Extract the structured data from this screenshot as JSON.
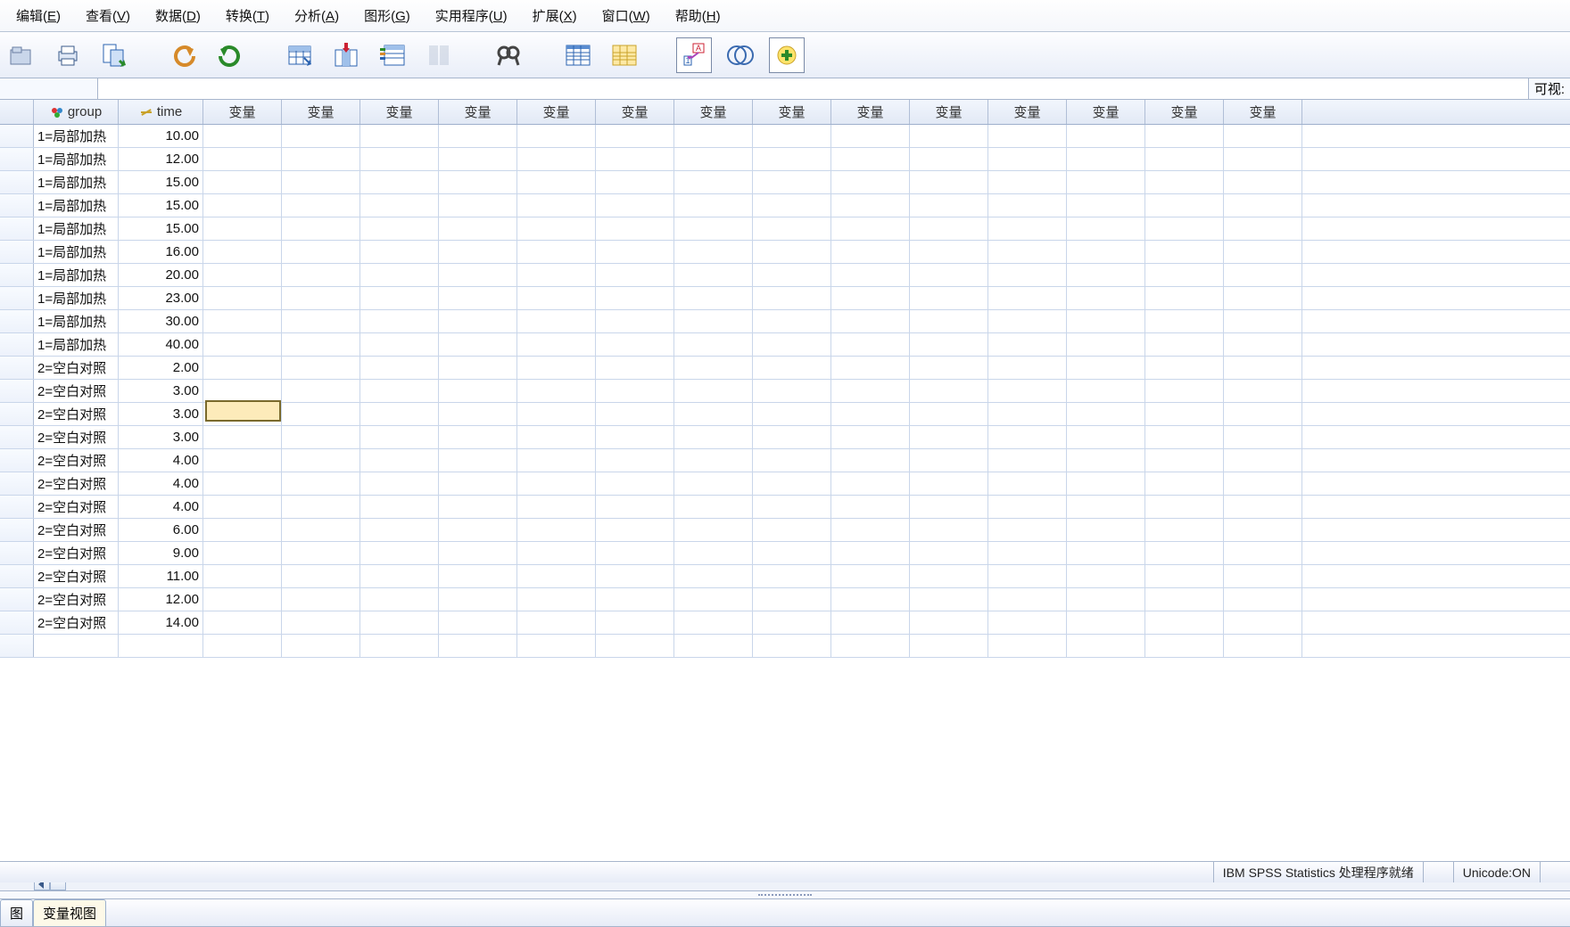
{
  "menu": {
    "items": [
      {
        "label": "编辑",
        "mn": "E"
      },
      {
        "label": "查看",
        "mn": "V"
      },
      {
        "label": "数据",
        "mn": "D"
      },
      {
        "label": "转换",
        "mn": "T"
      },
      {
        "label": "分析",
        "mn": "A"
      },
      {
        "label": "图形",
        "mn": "G"
      },
      {
        "label": "实用程序",
        "mn": "U"
      },
      {
        "label": "扩展",
        "mn": "X"
      },
      {
        "label": "窗口",
        "mn": "W"
      },
      {
        "label": "帮助",
        "mn": "H"
      }
    ]
  },
  "formulabar": {
    "right_label": "可视:"
  },
  "columns": {
    "group_header": "group",
    "time_header": "time",
    "blank_header": "变量"
  },
  "chart_data": {
    "type": "table",
    "columns": [
      "group",
      "time"
    ],
    "rows": [
      {
        "group": "1=局部加热",
        "time": "10.00"
      },
      {
        "group": "1=局部加热",
        "time": "12.00"
      },
      {
        "group": "1=局部加热",
        "time": "15.00"
      },
      {
        "group": "1=局部加热",
        "time": "15.00"
      },
      {
        "group": "1=局部加热",
        "time": "15.00"
      },
      {
        "group": "1=局部加热",
        "time": "16.00"
      },
      {
        "group": "1=局部加热",
        "time": "20.00"
      },
      {
        "group": "1=局部加热",
        "time": "23.00"
      },
      {
        "group": "1=局部加热",
        "time": "30.00"
      },
      {
        "group": "1=局部加热",
        "time": "40.00"
      },
      {
        "group": "2=空白对照",
        "time": "2.00"
      },
      {
        "group": "2=空白对照",
        "time": "3.00"
      },
      {
        "group": "2=空白对照",
        "time": "3.00"
      },
      {
        "group": "2=空白对照",
        "time": "3.00"
      },
      {
        "group": "2=空白对照",
        "time": "4.00"
      },
      {
        "group": "2=空白对照",
        "time": "4.00"
      },
      {
        "group": "2=空白对照",
        "time": "4.00"
      },
      {
        "group": "2=空白对照",
        "time": "6.00"
      },
      {
        "group": "2=空白对照",
        "time": "9.00"
      },
      {
        "group": "2=空白对照",
        "time": "11.00"
      },
      {
        "group": "2=空白对照",
        "time": "12.00"
      },
      {
        "group": "2=空白对照",
        "time": "14.00"
      }
    ],
    "active_cell": {
      "row_index": 12,
      "col": "变量",
      "col_index": 3
    }
  },
  "tabs": {
    "data_view": "图",
    "variable_view": "变量视图",
    "active": 1
  },
  "status": {
    "processor": "IBM SPSS Statistics 处理程序就绪",
    "unicode": "Unicode:ON"
  },
  "toolbar_icons": [
    "open",
    "print",
    "recent",
    "undo",
    "redo",
    "goto-case",
    "goto-var",
    "variables",
    "run",
    "find",
    "split",
    "weight",
    "value-labels",
    "use-sets",
    "add-var"
  ]
}
